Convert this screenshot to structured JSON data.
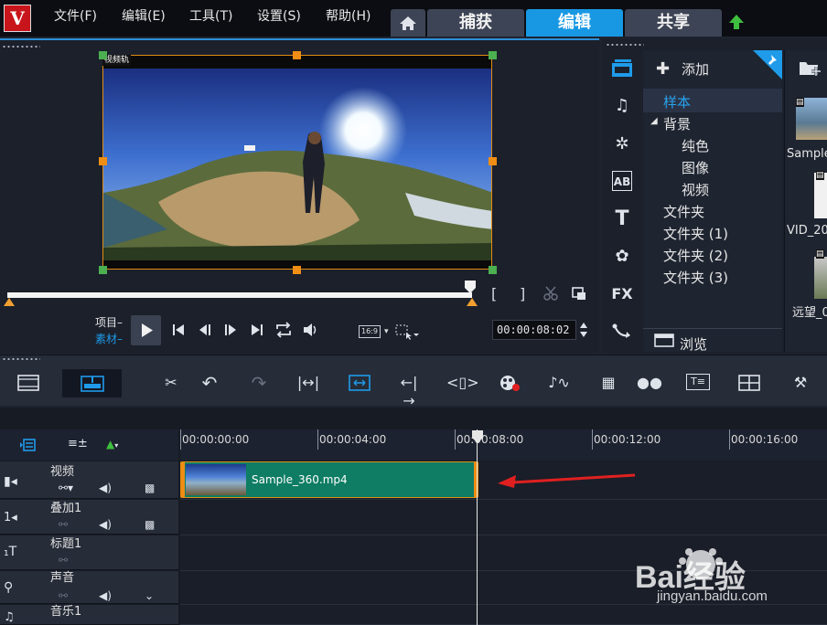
{
  "menubar": {
    "logo": "V",
    "items": [
      "文件(F)",
      "编辑(E)",
      "工具(T)",
      "设置(S)",
      "帮助(H)"
    ],
    "tabs": [
      "捕获",
      "编辑",
      "共享"
    ],
    "active_tab": "编辑"
  },
  "player": {
    "track_tag": "视频轨",
    "mode_project": "项目",
    "mode_clip": "素材",
    "aspect": "16:9",
    "timecode": "00:00:08:02"
  },
  "library": {
    "add_label": "添加",
    "tree": {
      "sample": "样本",
      "background": "背景",
      "background_children": [
        "纯色",
        "图像",
        "视频"
      ],
      "folders": [
        "文件夹",
        "文件夹 (1)",
        "文件夹 (2)",
        "文件夹 (3)"
      ]
    },
    "browse_label": "浏览",
    "thumb_labels": [
      "Sample",
      "VID_20",
      "远望_0"
    ]
  },
  "timeline": {
    "ruler": [
      "00:00:00:00",
      "00:00:04:00",
      "00:00:08:00",
      "00:00:12:00",
      "00:00:16:00"
    ],
    "tracks": [
      "视频",
      "叠加1",
      "标题1",
      "声音",
      "音乐1"
    ],
    "clip_name": "Sample_360.mp4"
  },
  "colors": {
    "accent": "#1898e3",
    "clip": "#0f7d64",
    "clip_border": "#e09018",
    "arrow": "#e02020"
  },
  "watermark": {
    "brand": "Bai经验",
    "url": "jingyan.baidu.com"
  }
}
